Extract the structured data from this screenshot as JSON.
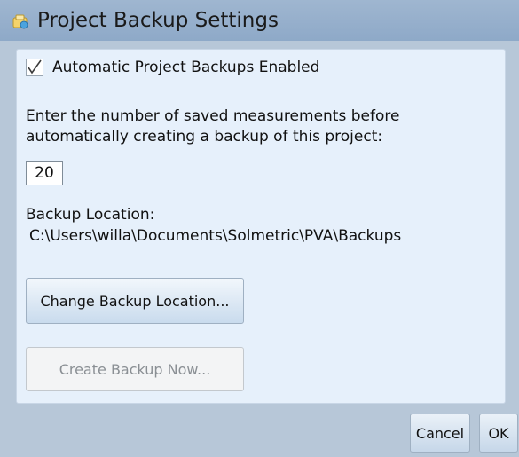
{
  "window": {
    "title": "Project Backup Settings",
    "icon": "backup-settings-icon"
  },
  "settings": {
    "auto_backup_label": "Automatic Project Backups Enabled",
    "auto_backup_checked": true,
    "description": "Enter the number of saved measurements before automatically creating a backup of this project:",
    "measurement_count": "20",
    "location_label": "Backup Location:",
    "location_path": "C:\\Users\\willa\\Documents\\Solmetric\\PVA\\Backups"
  },
  "buttons": {
    "change_location": "Change Backup Location...",
    "create_backup": "Create Backup Now...",
    "cancel": "Cancel",
    "ok": "OK"
  },
  "colors": {
    "titlebar": "#8ea9c8",
    "panel": "#e6f0fb",
    "dialog_background": "#b7c7d8"
  }
}
